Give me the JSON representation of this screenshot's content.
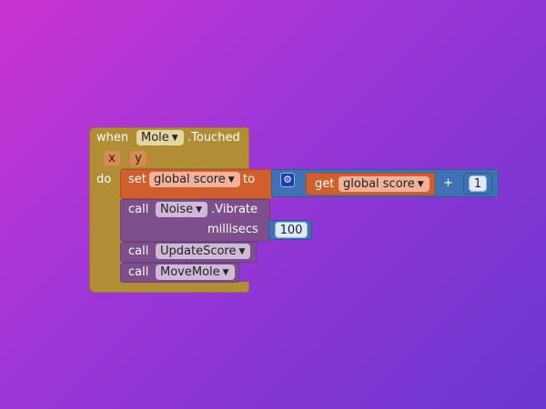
{
  "colors": {
    "event": "#b18e35",
    "event_arg": "#d98a52",
    "variable": "#d05f2d",
    "procedure": "#7d4f8d",
    "math": "#3f71b5",
    "background_start": "#c934d3",
    "background_end": "#6a36cf"
  },
  "event_block": {
    "when": "when",
    "component": "Mole",
    "event_name": ".Touched",
    "params": [
      "x",
      "y"
    ],
    "do": "do"
  },
  "set_block": {
    "set": "set",
    "variable": "global score",
    "to": "to",
    "mutator_icon": "gear-icon",
    "get_block": {
      "get": "get",
      "variable": "global score"
    },
    "operator": "+",
    "operand": "1"
  },
  "vibrate_block": {
    "call": "call",
    "component": "Noise",
    "method": ".Vibrate",
    "arg_label": "millisecs",
    "arg_value": "100"
  },
  "update_score_block": {
    "call": "call",
    "procedure": "UpdateScore"
  },
  "move_mole_block": {
    "call": "call",
    "procedure": "MoveMole"
  }
}
